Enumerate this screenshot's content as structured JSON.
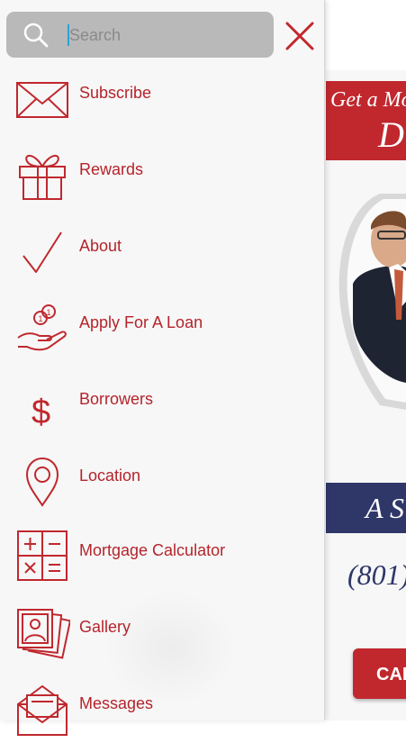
{
  "search": {
    "placeholder": "Search"
  },
  "icons": {
    "search": "search-icon",
    "close": "close-icon",
    "hamburger": "hamburger-menu-icon"
  },
  "menu": {
    "items": [
      {
        "label": "Subscribe",
        "icon": "envelope-icon"
      },
      {
        "label": "Rewards",
        "icon": "gift-icon"
      },
      {
        "label": "About",
        "icon": "checkmark-icon"
      },
      {
        "label": "Apply For A Loan",
        "icon": "hand-coins-icon"
      },
      {
        "label": "Borrowers",
        "icon": "dollar-sign-icon"
      },
      {
        "label": "Location",
        "icon": "map-pin-icon"
      },
      {
        "label": "Mortgage Calculator",
        "icon": "calculator-icon"
      },
      {
        "label": "Gallery",
        "icon": "photo-gallery-icon"
      },
      {
        "label": "Messages",
        "icon": "open-envelope-icon"
      }
    ]
  },
  "background": {
    "banner_line1": "Get a Mo",
    "banner_line2": "D",
    "strip_text": "A S",
    "phone": "(801)",
    "call_button": "CAL"
  },
  "colors": {
    "accent": "#c0282e",
    "navy": "#2f3769",
    "drawer_bg": "#f7f7f7",
    "search_bg": "#b9b9b9"
  }
}
